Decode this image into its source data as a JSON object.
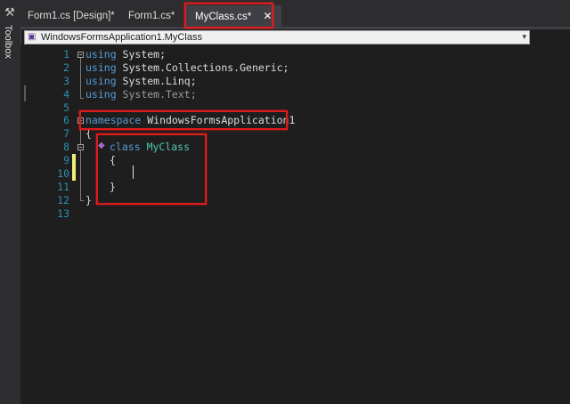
{
  "toolbox": {
    "label": "Toolbox",
    "icon": "toolbox-icon"
  },
  "tabs": [
    {
      "label": "Form1.cs [Design]*",
      "active": false
    },
    {
      "label": "Form1.cs*",
      "active": false
    },
    {
      "label": "MyClass.cs*",
      "active": true,
      "close": "✕"
    }
  ],
  "navbar": {
    "text": "WindowsFormsApplication1.MyClass",
    "arrow": "▾"
  },
  "editor": {
    "line_numbers": [
      "1",
      "2",
      "3",
      "4",
      "5",
      "6",
      "7",
      "8",
      "9",
      "10",
      "11",
      "12",
      "13"
    ],
    "lines": {
      "l1_kw": "using",
      "l1_rest": " System;",
      "l2_kw": "using",
      "l2_rest": " System.Collections.Generic;",
      "l3_kw": "using",
      "l3_rest": " System.Linq;",
      "l4_kw": "using",
      "l4_rest": " System.Text;",
      "l6_kw": "namespace",
      "l6_rest": " WindowsFormsApplication1",
      "l7": "{",
      "l8_kw": "class",
      "l8_type": "MyClass",
      "l9": "{",
      "l11": "}",
      "l12": "}"
    }
  },
  "colors": {
    "keyword": "#569cd6",
    "type": "#4ec9b0",
    "line_number": "#2b91af",
    "highlight": "#e01b1b",
    "changed_line": "#efef7a"
  }
}
